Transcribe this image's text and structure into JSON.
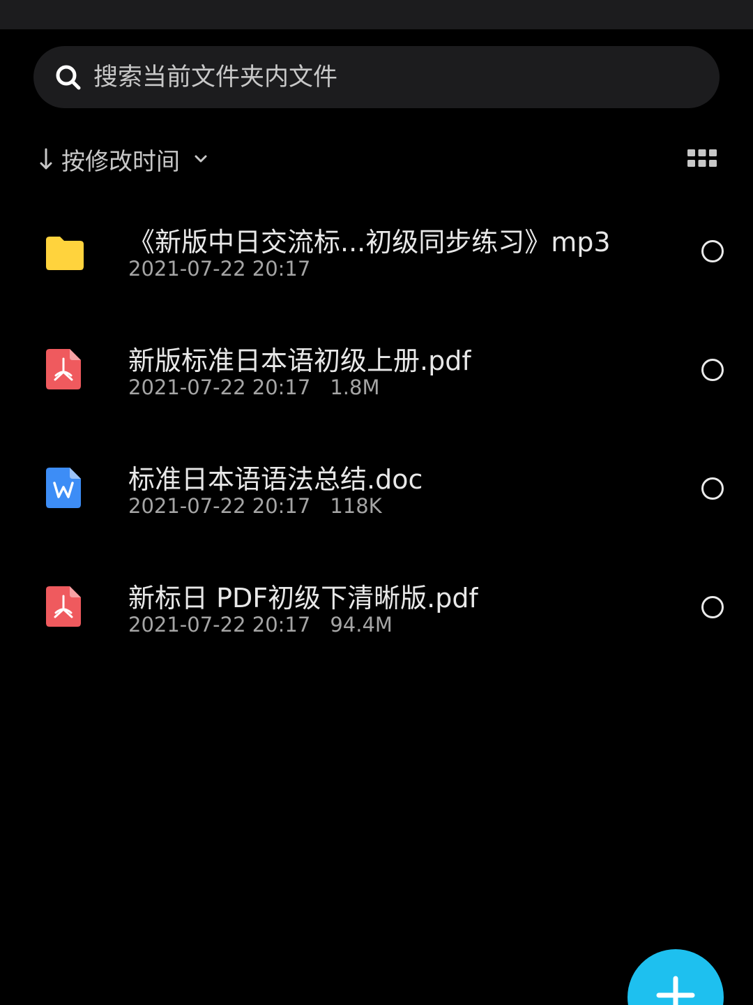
{
  "search": {
    "placeholder": "搜索当前文件夹内文件"
  },
  "sort": {
    "label": "按修改时间"
  },
  "files": [
    {
      "type": "folder",
      "name": "《新版中日交流标...初级同步练习》mp3",
      "date": "2021-07-22 20:17",
      "size": ""
    },
    {
      "type": "pdf",
      "name": "新版标准日本语初级上册.pdf",
      "date": "2021-07-22 20:17",
      "size": "1.8M"
    },
    {
      "type": "doc",
      "name": "标准日本语语法总结.doc",
      "date": "2021-07-22 20:17",
      "size": "118K"
    },
    {
      "type": "pdf",
      "name": "新标日 PDF初级下清晰版.pdf",
      "date": "2021-07-22 20:17",
      "size": "94.4M"
    }
  ],
  "colors": {
    "background": "#000000",
    "surface": "#1c1c1e",
    "folder": "#ffd33d",
    "pdf": "#ef5a5e",
    "doc": "#3d8df6",
    "fab": "#1ec0ef"
  },
  "icons": {
    "search": "search-icon",
    "sort": "arrow-down-icon",
    "dropdown": "chevron-down-icon",
    "view": "grid-icon",
    "folder": "folder-icon",
    "pdf": "pdf-file-icon",
    "doc": "word-file-icon",
    "add": "plus-icon"
  }
}
